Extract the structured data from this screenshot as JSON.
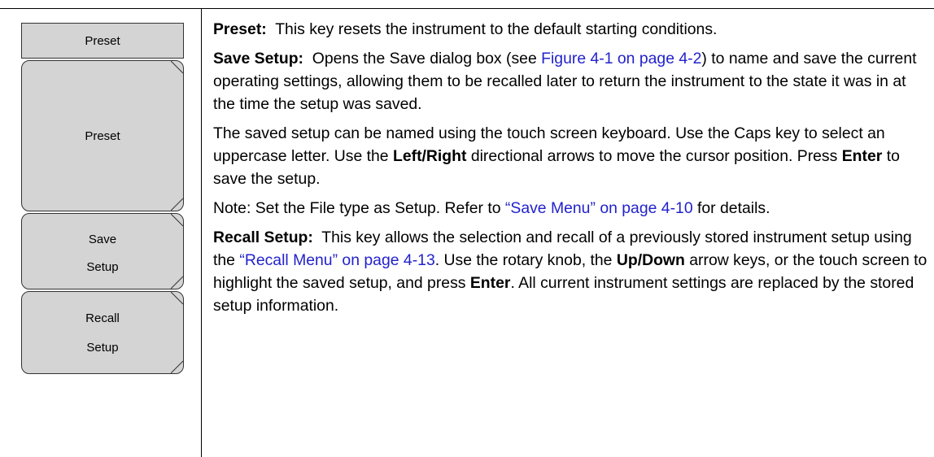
{
  "menu": {
    "title": "Preset",
    "keys": [
      {
        "line1": "Preset",
        "line2": ""
      },
      {
        "line1": "Save",
        "line2": "Setup"
      },
      {
        "line1": "Recall",
        "line2": "Setup"
      }
    ]
  },
  "preset": {
    "term": "Preset:",
    "text": "This key resets the instrument to the default starting conditions."
  },
  "save_setup": {
    "term": "Save Setup:",
    "text_a": "Opens the Save dialog box (see",
    "link": "Figure 4-1 on page 4-2",
    "text_b": ") to name and save the current operating settings, allowing them to be recalled later to return the instrument to the state it was in at the time the setup was saved."
  },
  "named": {
    "text_a": "The saved setup can be named using the touch screen keyboard. Use the Caps key to select an uppercase letter. Use the",
    "bold_a": "Left/Right",
    "text_b": "directional arrows to move the cursor position. Press",
    "bold_b": "Enter",
    "text_c": "to save the setup."
  },
  "note": {
    "text_a": "Note: Set the File type as Setup. Refer to",
    "link": "“Save Menu” on page 4-10",
    "text_b": "for details."
  },
  "recall_setup": {
    "term": "Recall Setup:",
    "text_a": "This key allows the selection and recall of a previously stored instrument setup using the",
    "link": "“Recall Menu” on page 4-13",
    "text_b": ". Use the rotary knob, the",
    "bold_a": "Up/Down",
    "text_c": "arrow keys, or the touch screen to highlight the saved setup, and press",
    "bold_b": "Enter",
    "text_d": ". All current instrument settings are replaced by the stored setup information."
  }
}
